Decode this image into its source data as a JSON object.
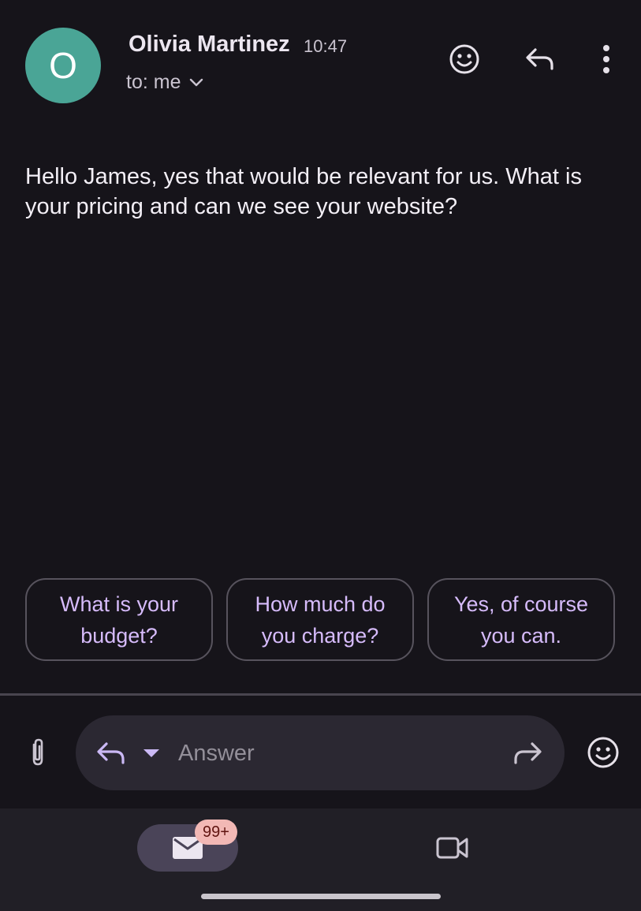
{
  "header": {
    "avatar_letter": "O",
    "sender": "Olivia Martinez",
    "time": "10:47",
    "recipient": "to: me",
    "icons": [
      "add-reaction-icon",
      "reply-icon",
      "more-vert-icon",
      "chevron-down-icon"
    ]
  },
  "message": {
    "body": "Hello James, yes that would be relevant for us. What is your pricing and can we see your website?"
  },
  "smart_replies": [
    "What is your budget?",
    "How much do you charge?",
    "Yes, of course you can."
  ],
  "compose": {
    "placeholder": "Answer",
    "icons": [
      "attach-icon",
      "reply-icon",
      "dropdown-icon",
      "forward-icon",
      "emoji-icon"
    ]
  },
  "bottom_nav": {
    "mail_badge": "99+",
    "icons": [
      "mail-icon",
      "video-camera-icon"
    ]
  },
  "colors": {
    "background": "#16141a",
    "avatar": "#4aa596",
    "chip_text": "#d6bbfb",
    "answer_bar": "#2b2832",
    "nav_active": "#4a4458",
    "badge": "#f2b8b5"
  }
}
